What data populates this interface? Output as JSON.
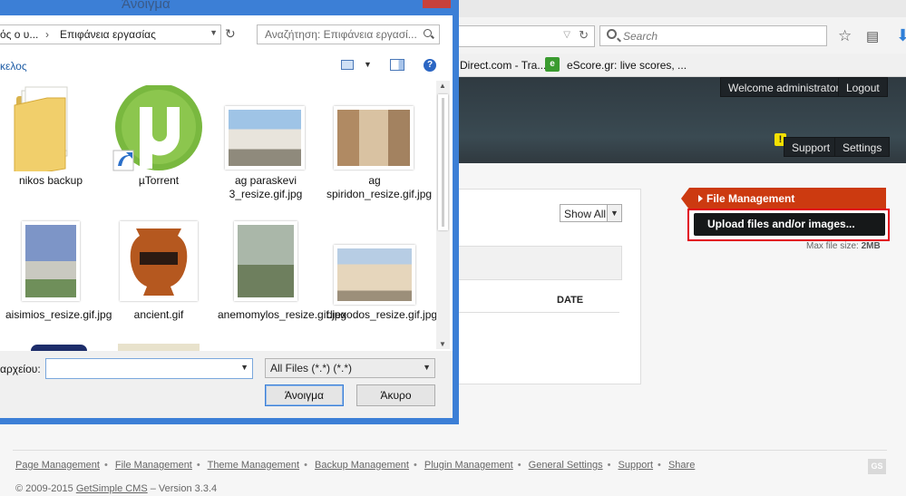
{
  "browser": {
    "search_placeholder": "Search",
    "bookmarks": [
      "Direct.com - Tra...",
      "eScore.gr: live scores, ..."
    ]
  },
  "cms": {
    "header": {
      "welcome": "Welcome administrator!",
      "logout": "Logout",
      "support": "Support",
      "settings": "Settings"
    },
    "filter_select": "Show All",
    "table_header_date": "DATE",
    "sidebar": {
      "tab_label": "File Management",
      "upload_button": "Upload files and/or images...",
      "max_file_size_label": "Max file size:",
      "max_file_size_value": "2MB"
    },
    "footer": {
      "links": [
        "Page Management",
        "File Management",
        "Theme Management",
        "Backup Management",
        "Plugin Management",
        "General Settings",
        "Support",
        "Share"
      ],
      "copyright_prefix": "© 2009-2015",
      "cms_link": "GetSimple CMS",
      "version": "– Version 3.3.4",
      "logo_text": "GS"
    }
  },
  "dialog": {
    "title": "Άνοιγμα",
    "address": {
      "segment1": "ός ο υ...",
      "segment2": "Επιφάνεια εργασίας"
    },
    "search_placeholder": "Αναζήτηση: Επιφάνεια εργασί...",
    "command_label": "κελος",
    "files": [
      {
        "name": "nikos backup",
        "kind": "folder"
      },
      {
        "name": "µTorrent",
        "kind": "shortcut"
      },
      {
        "name": "ag paraskevi 3_resize.gif.jpg",
        "kind": "image"
      },
      {
        "name": "ag spiridon_resize.gif.jpg",
        "kind": "image"
      },
      {
        "name": "aisimios_resize.gif.jpg",
        "kind": "image"
      },
      {
        "name": "ancient.gif",
        "kind": "image"
      },
      {
        "name": "anemomylos_resize.gif.jpg",
        "kind": "image"
      },
      {
        "name": "diexodos_resize.gif.jpg",
        "kind": "image"
      }
    ],
    "filename_label": "αρχείου:",
    "filename_value": "",
    "filter_value": "All Files (*.*) (*.*)",
    "open_button": "Άνοιγμα",
    "cancel_button": "Άκυρο"
  },
  "colors": {
    "dialog_frame": "#3c7fd6",
    "file_management_tab": "#cc3a10",
    "highlight_outline": "#e2001a",
    "cms_header": "#34424a"
  }
}
